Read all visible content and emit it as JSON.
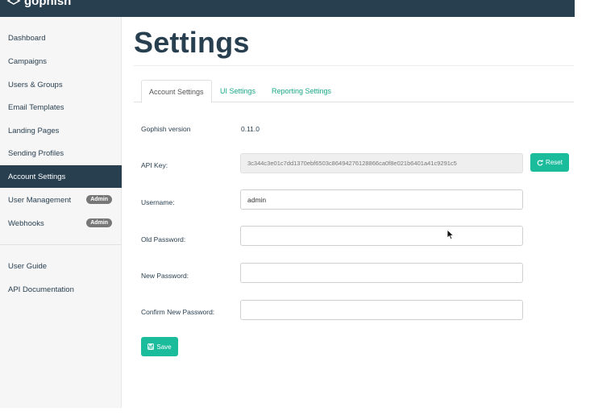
{
  "brand": {
    "name": "gophish"
  },
  "sidebar": {
    "items": [
      {
        "label": "Dashboard"
      },
      {
        "label": "Campaigns"
      },
      {
        "label": "Users & Groups"
      },
      {
        "label": "Email Templates"
      },
      {
        "label": "Landing Pages"
      },
      {
        "label": "Sending Profiles"
      },
      {
        "label": "Account Settings",
        "active": true
      },
      {
        "label": "User Management",
        "badge": "Admin"
      },
      {
        "label": "Webhooks",
        "badge": "Admin"
      }
    ],
    "footer": [
      {
        "label": "User Guide"
      },
      {
        "label": "API Documentation"
      }
    ]
  },
  "page": {
    "title": "Settings"
  },
  "tabs": [
    {
      "label": "Account Settings",
      "active": true
    },
    {
      "label": "UI Settings"
    },
    {
      "label": "Reporting Settings"
    }
  ],
  "form": {
    "version_label": "Gophish version",
    "version_value": "0.11.0",
    "api_key_label": "API Key:",
    "api_key_value": "3c344c3e01c7dd1370ebf6503c86494276128866ca0f8e021b6401a41c9291c5",
    "reset_label": "Reset",
    "username_label": "Username:",
    "username_value": "admin",
    "old_password_label": "Old Password:",
    "new_password_label": "New Password:",
    "confirm_password_label": "Confirm New Password:",
    "save_label": "Save"
  },
  "colors": {
    "navy": "#283f50",
    "accent": "#1abc9c",
    "badge": "#777777"
  }
}
